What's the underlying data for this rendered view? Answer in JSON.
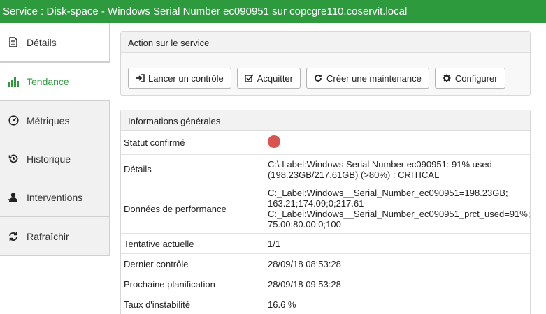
{
  "window": {
    "title": "Service : Disk-space - Windows Serial Number ec090951 sur copcgre110.coservit.local"
  },
  "sidebar": {
    "items": [
      {
        "label": "Détails",
        "icon": "document-icon"
      },
      {
        "label": "Tendance",
        "icon": "bar-chart-icon"
      },
      {
        "label": "Métriques",
        "icon": "gauge-icon"
      },
      {
        "label": "Historique",
        "icon": "history-icon"
      },
      {
        "label": "Interventions",
        "icon": "user-icon"
      },
      {
        "label": "Rafraîchir",
        "icon": "refresh-icon"
      }
    ],
    "active": "Tendance",
    "accent_color": "#2e9a3e"
  },
  "actions": {
    "title": "Action sur le service",
    "buttons": [
      {
        "label": "Lancer un contrôle",
        "icon": "sign-in-icon"
      },
      {
        "label": "Acquitter",
        "icon": "checkbox-icon"
      },
      {
        "label": "Créer une maintenance",
        "icon": "refresh-icon"
      },
      {
        "label": "Configurer",
        "icon": "gear-icon"
      }
    ]
  },
  "info": {
    "title": "Informations générales",
    "status_label": "Statut confirmé",
    "status_color": "#d9534f",
    "details_label": "Détails",
    "details_line1": "C:\\ Label:Windows Serial Number ec090951: 91% used",
    "details_line2": "(198.23GB/217.61GB) (>80%) : CRITICAL",
    "perf_label": "Données de performance",
    "perf_line1": "C:_Label:Windows__Serial_Number_ec090951=198.23GB;",
    "perf_line2": "163.21;174.09;0;217.61",
    "perf_line3": "C:_Label:Windows__Serial_Number_ec090951_prct_used=91%;",
    "perf_line4": "75.00;80.00;0;100",
    "attempt_label": "Tentative actuelle",
    "attempt_value": "1/1",
    "last_check_label": "Dernier contrôle",
    "last_check_value": "28/09/18 08:53:28",
    "next_check_label": "Prochaine planification",
    "next_check_value": "28/09/18 09:53:28",
    "flap_label": "Taux d'instabilité",
    "flap_value": "16.6 %"
  }
}
